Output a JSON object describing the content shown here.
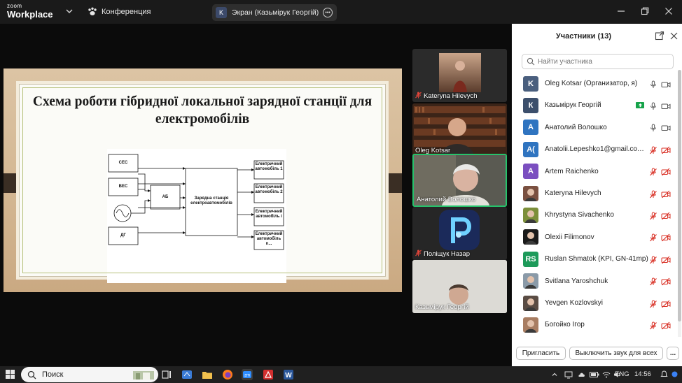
{
  "titlebar": {
    "logo_top": "zoom",
    "logo_bottom": "Workplace",
    "meeting_label": "Конференция",
    "share_badge": "K",
    "share_label": "Экран (Казьмірук Георгій)"
  },
  "slide": {
    "title": "Схема роботи гібридної  локальної зарядної станції для електромобілів",
    "diagram": {
      "sources": [
        "СЕС",
        "ВЕС",
        "ДГ"
      ],
      "battery": "АБ",
      "station": "Зарядна станція електроавтомобілів",
      "vehicles": [
        "Електричний автомобіль 1",
        "Електричний автомобіль 2",
        "Електричний автомобіль і",
        "Електричний автомобіль n..."
      ]
    }
  },
  "tiles": [
    {
      "name": "Kateryna Hilevych",
      "muted": true
    },
    {
      "name": "Oleg Kotsar",
      "muted": false
    },
    {
      "name": "Анатолий Волошко",
      "muted": false,
      "active": true
    },
    {
      "name": "Поліщук Назар",
      "muted": true
    },
    {
      "name": "Казьмірук Георгій",
      "muted": false
    }
  ],
  "panel": {
    "title": "Участники (13)",
    "search_placeholder": "Найти участника",
    "participants": [
      {
        "initials": "K",
        "name": "Oleg Kotsar (Организатор, я)",
        "color": "#4a5f7e",
        "mic": "on",
        "cam": "on"
      },
      {
        "initials": "К",
        "name": "Казьмірук Георгій",
        "color": "#3c4f6c",
        "mic": "on",
        "cam": "on",
        "sharing": true
      },
      {
        "initials": "А",
        "name": "Анатолий Волошко",
        "color": "#2f74c0",
        "mic": "on",
        "cam": "on"
      },
      {
        "initials": "A(",
        "name": "Anatolii.Lepeshko1@gmail.com...",
        "color": "#2f74c0",
        "mic": "off",
        "cam": "off"
      },
      {
        "initials": "A",
        "name": "Artem Raichenko",
        "color": "#7b4fc0",
        "mic": "off",
        "cam": "off"
      },
      {
        "initials": "",
        "name": "Kateryna Hilevych",
        "color": "#7a5040",
        "mic": "off",
        "cam": "off"
      },
      {
        "initials": "",
        "name": "Khrystyna Sivachenko",
        "color": "#7c8f3a",
        "mic": "off",
        "cam": "off"
      },
      {
        "initials": "",
        "name": "Olexii Filimonov",
        "color": "#1a1a1a",
        "mic": "off",
        "cam": "off"
      },
      {
        "initials": "RS",
        "name": "Ruslan Shmatok (KPI, GN-41mp)",
        "color": "#1d9a5a",
        "mic": "off",
        "cam": "off"
      },
      {
        "initials": "",
        "name": "Svitlana Yaroshchuk",
        "color": "#8a9aa8",
        "mic": "off",
        "cam": "off"
      },
      {
        "initials": "",
        "name": "Yevgen Kozlovskyi",
        "color": "#5a4c44",
        "mic": "off",
        "cam": "off"
      },
      {
        "initials": "",
        "name": "Богойко Ігор",
        "color": "#a87d62",
        "mic": "off",
        "cam": "off"
      }
    ],
    "invite_label": "Пригласить",
    "mute_all_label": "Выключить звук для всех",
    "more_label": "..."
  },
  "taskbar": {
    "search_label": "Поиск",
    "lang": "ENG",
    "time": "14:56"
  }
}
